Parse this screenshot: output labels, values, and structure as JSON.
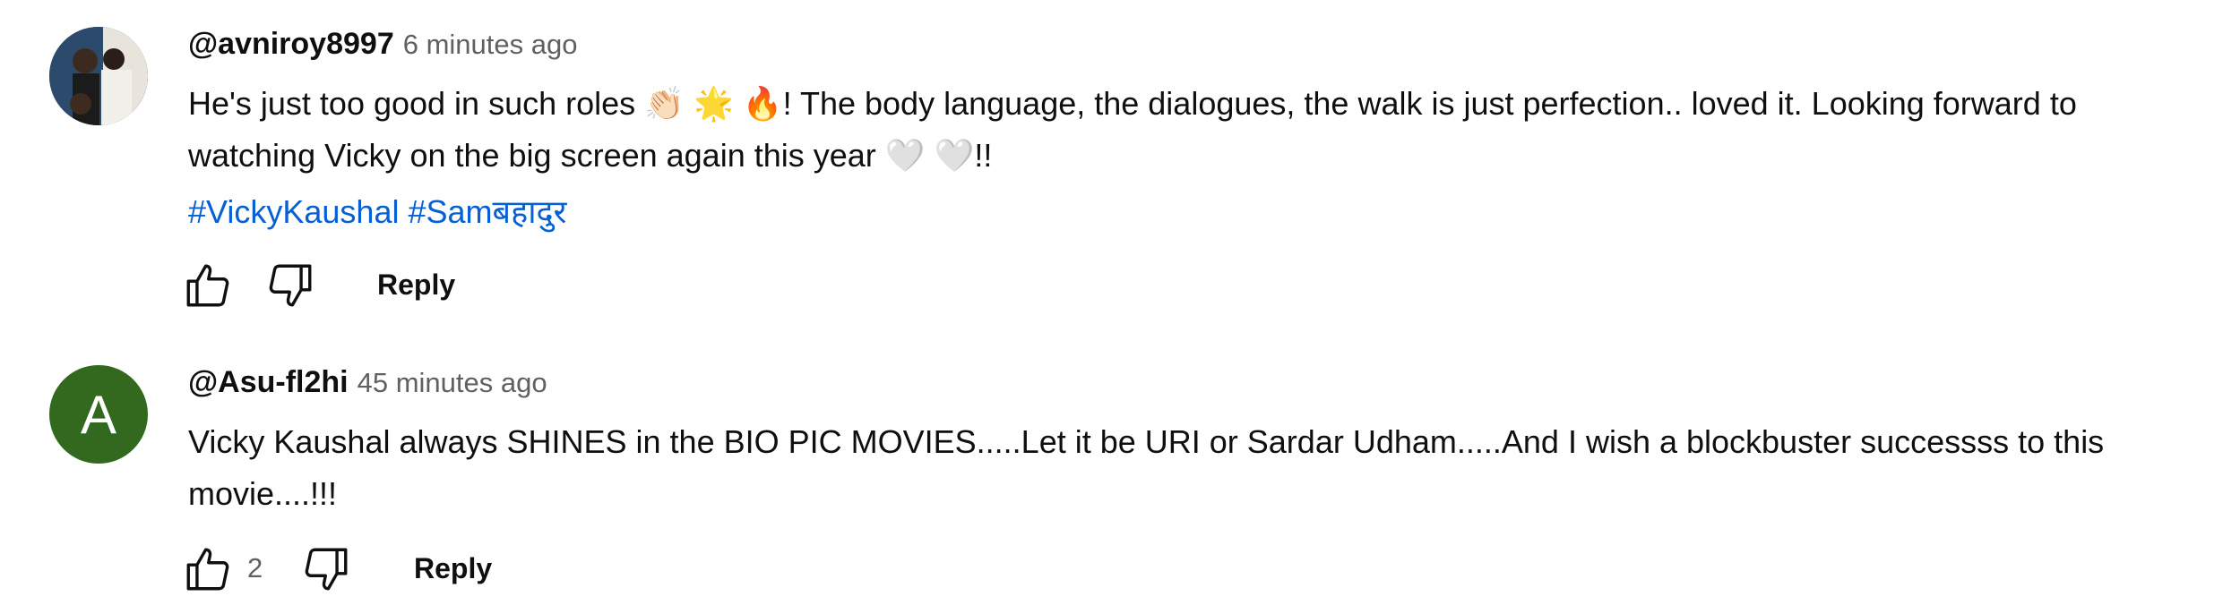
{
  "comments": [
    {
      "author": "@avniroy8997",
      "time": "6 minutes ago",
      "lines": [
        "He's just too good in such roles 👏🏻 🌟 🔥! The body language, the dialogues, the walk is just perfection.. loved it. Looking forward to",
        "watching Vicky on the big screen again this year 🤍 🤍!!"
      ],
      "hashtags": "#VickyKaushal #Samबहादुर",
      "likes": "",
      "reply_label": "Reply",
      "avatar_icon": "profile-photo"
    },
    {
      "author": "@Asu-fl2hi",
      "time": "45 minutes ago",
      "lines": [
        "Vicky Kaushal always SHINES in the BIO PIC MOVIES.....Let it be URI or Sardar Udham.....And I wish a blockbuster successss to this",
        "movie....!!!"
      ],
      "likes": "2",
      "reply_label": "Reply",
      "avatar_letter": "A",
      "avatar_color": "#33691e"
    }
  ],
  "colors": {
    "text": "#0f0f0f",
    "secondary": "#606060",
    "link": "#065fd4"
  }
}
